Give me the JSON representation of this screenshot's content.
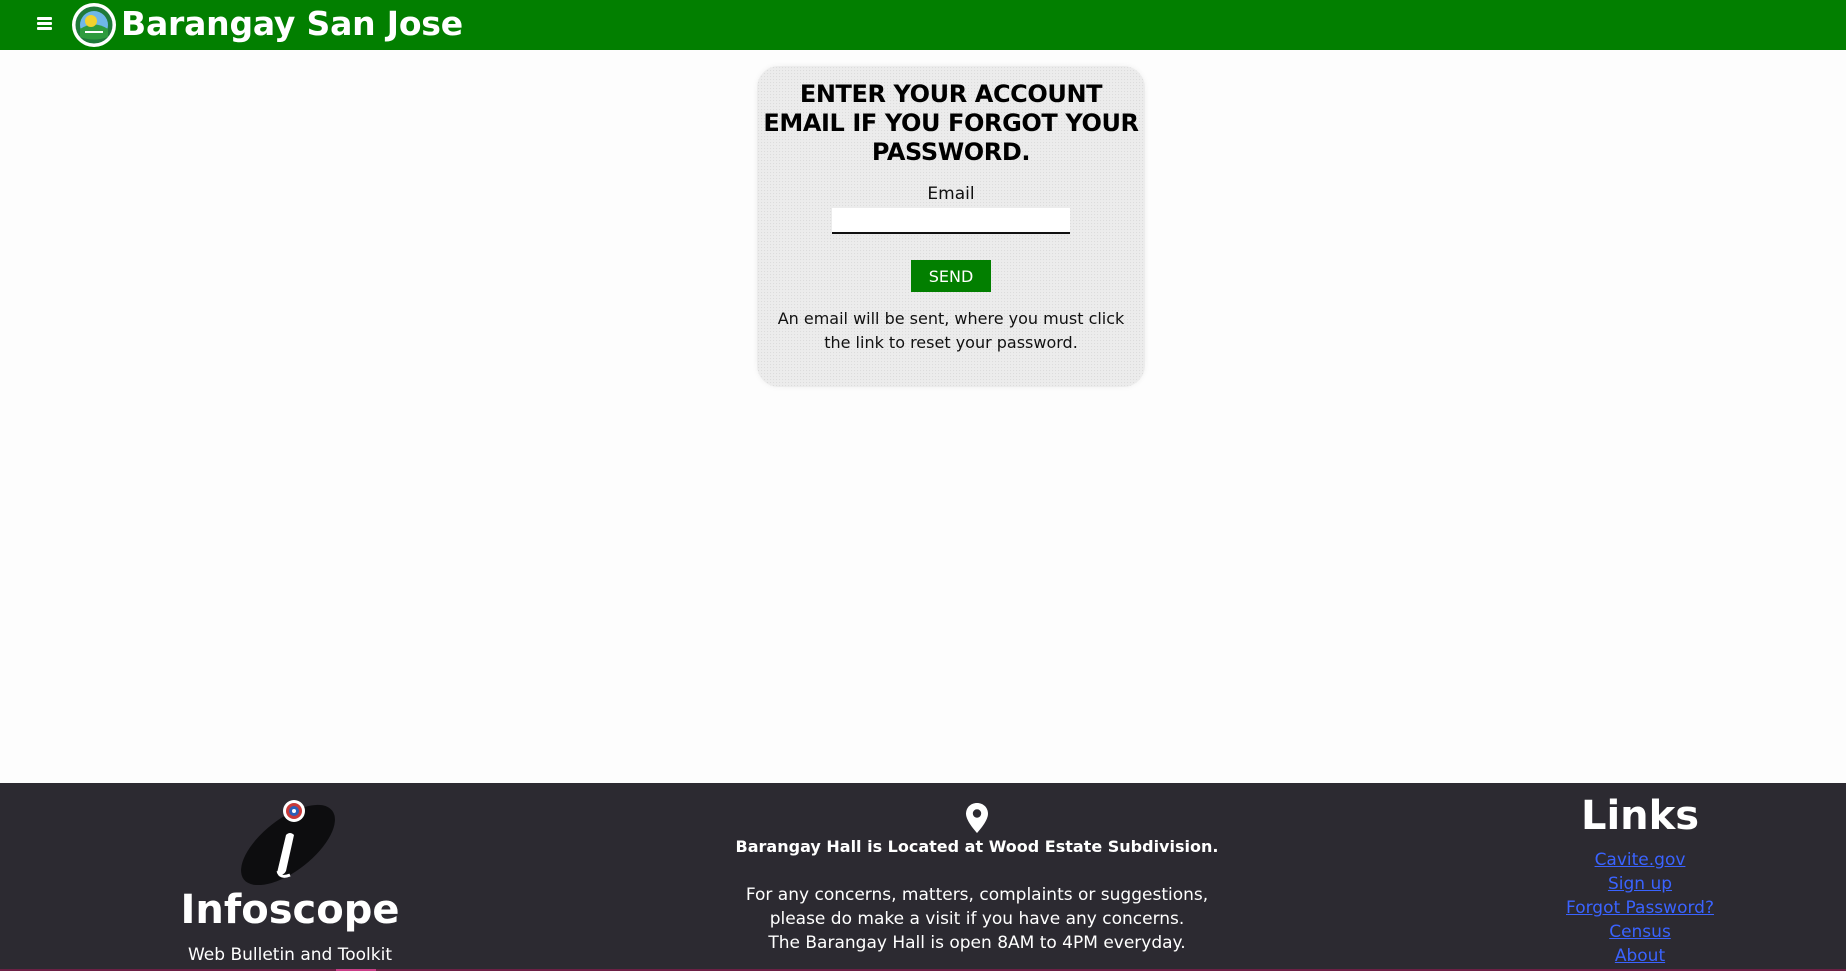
{
  "header": {
    "site_title": "Barangay San Jose",
    "menu_icon": "hamburger-menu-icon",
    "logo": "barangay-seal-logo",
    "bg_color": "#027f00"
  },
  "reset_form": {
    "title": "ENTER YOUR ACCOUNT EMAIL IF YOU FORGOT YOUR PASSWORD.",
    "email_label": "Email",
    "email_value": "",
    "send_label": "SEND",
    "note": "An email will be sent, where you must click the link to reset your password.",
    "button_color": "#027f00"
  },
  "footer": {
    "brand": {
      "name": "Infoscope",
      "tagline": "Web Bulletin and Toolkit",
      "logo": "infoscope-logo"
    },
    "location": {
      "icon": "location-pin-icon",
      "heading": "Barangay Hall is Located at Wood Estate Subdivision.",
      "line1": "For any concerns, matters, complaints or suggestions,",
      "line2": "please do make a visit if you have any concerns.",
      "line3": "The Barangay Hall is open 8AM to 4PM everyday."
    },
    "links": {
      "title": "Links",
      "items": [
        {
          "label": "Cavite.gov"
        },
        {
          "label": "Sign up"
        },
        {
          "label": "Forgot Password?"
        },
        {
          "label": "Census"
        },
        {
          "label": "About"
        }
      ]
    },
    "bg_color": "#2c2a31",
    "link_color": "#3a63ff"
  }
}
